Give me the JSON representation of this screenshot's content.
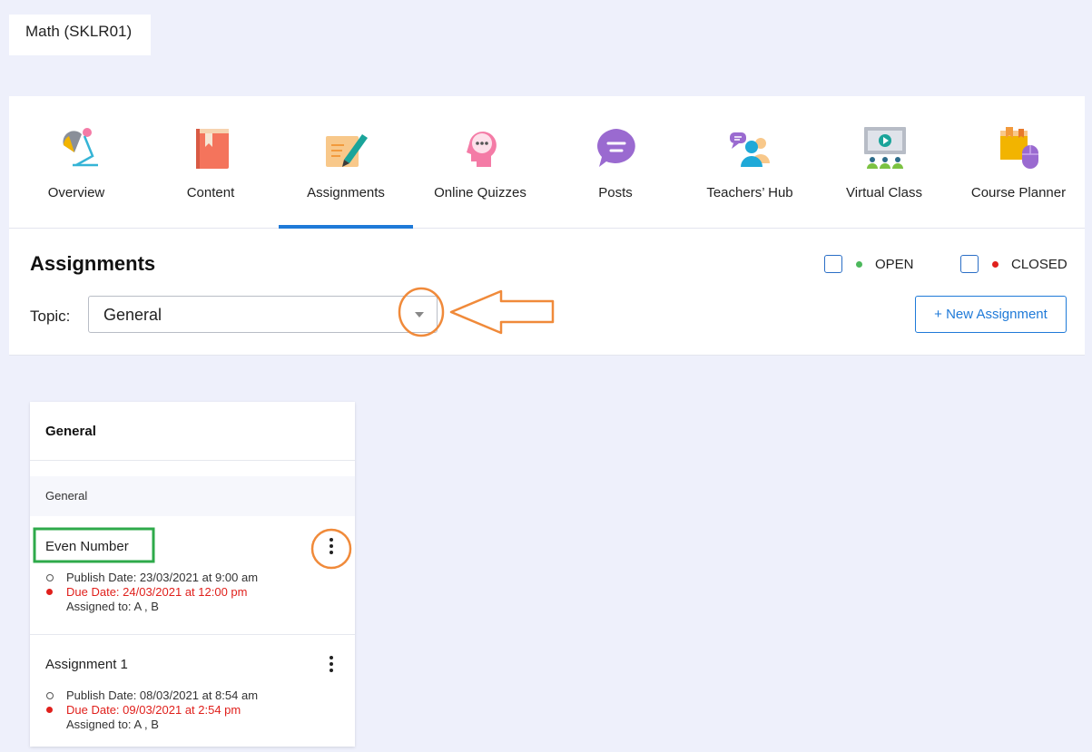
{
  "course": {
    "title": "Math (SKLR01)"
  },
  "tabs": [
    {
      "label": "Overview",
      "icon": "desk-lamp-icon"
    },
    {
      "label": "Content",
      "icon": "book-icon"
    },
    {
      "label": "Assignments",
      "icon": "assignment-pen-icon",
      "active": true
    },
    {
      "label": "Online Quizzes",
      "icon": "head-chat-icon"
    },
    {
      "label": "Posts",
      "icon": "speech-bubble-icon"
    },
    {
      "label": "Teachers’ Hub",
      "icon": "teachers-chat-icon"
    },
    {
      "label": "Virtual Class",
      "icon": "video-class-icon"
    },
    {
      "label": "Course Planner",
      "icon": "planner-mouse-icon"
    }
  ],
  "assignments_panel": {
    "title": "Assignments",
    "legend": [
      {
        "label": "OPEN",
        "color": "#4cb85c"
      },
      {
        "label": "CLOSED",
        "color": "#e0201c"
      }
    ],
    "topic_label": "Topic:",
    "topic_value": "General",
    "new_button": "+ New Assignment"
  },
  "topic_card": {
    "title": "General",
    "section": "General",
    "items": [
      {
        "name": "Even Number",
        "publish": "Publish Date: 23/03/2021 at 9:00 am",
        "due": "Due Date: 24/03/2021 at 12:00 pm",
        "assigned": "Assigned to: A , B"
      },
      {
        "name": "Assignment 1",
        "publish": "Publish Date: 08/03/2021 at 8:54 am",
        "due": "Due Date: 09/03/2021 at 2:54 pm",
        "assigned": "Assigned to: A , B"
      }
    ]
  },
  "colors": {
    "accent": "#1f7ad8",
    "due_red": "#e0201c",
    "annotation_orange": "#f08a3a",
    "annotation_green": "#2eaa4a"
  }
}
